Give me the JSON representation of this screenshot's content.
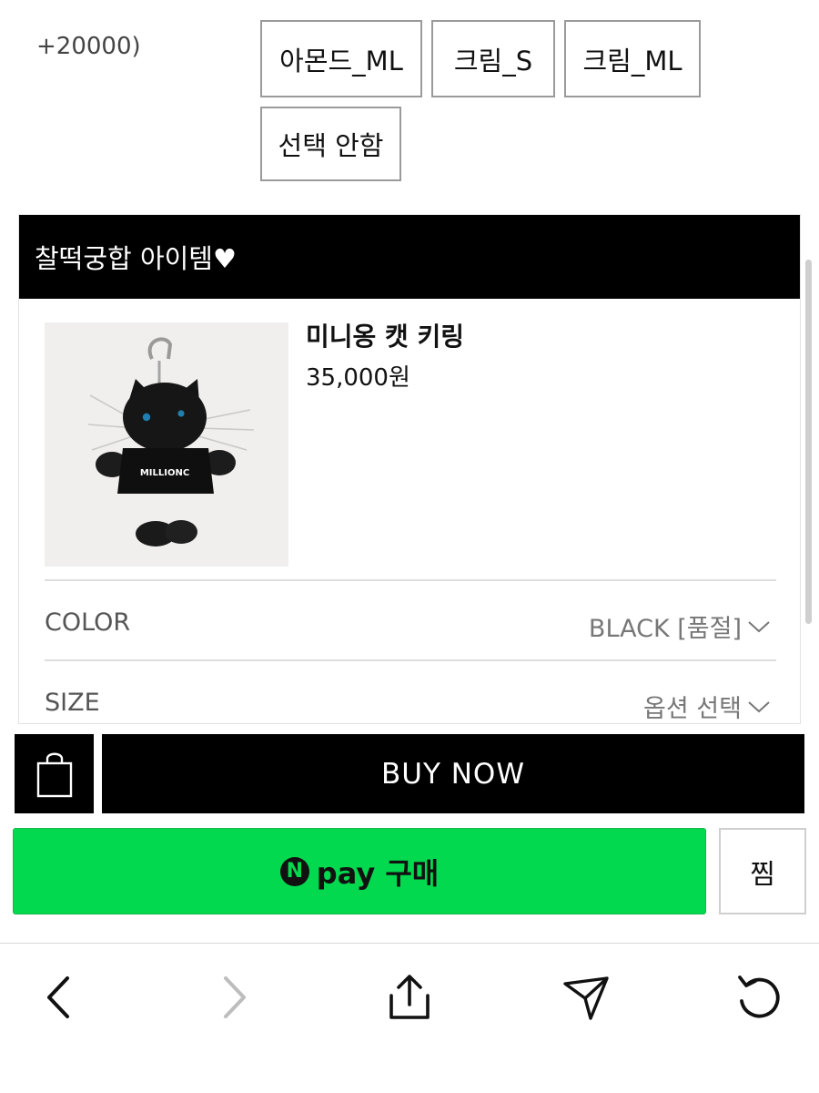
{
  "options": {
    "prev_label": "+20000)",
    "buttons": [
      "아몬드_ML",
      "크림_S",
      "크림_ML",
      "선택 안함"
    ]
  },
  "recommend": {
    "title": "찰떡궁합 아이템♥",
    "product": {
      "name": "미니옹 캣 키링",
      "price": "35,000원",
      "shirt_text": "MILLIONC"
    },
    "rows": [
      {
        "label": "COLOR",
        "value": "BLACK [품절]"
      },
      {
        "label": "SIZE",
        "value": "옵션 선택"
      }
    ]
  },
  "actions": {
    "buy_now": "BUY NOW",
    "npay_logo": "N",
    "npay_label": "pay 구매",
    "zzim": "찜"
  },
  "icons": {
    "bag": "shopping-bag-icon",
    "back": "arrow-left-icon",
    "forward": "arrow-right-icon",
    "share": "share-icon",
    "send": "send-icon",
    "refresh": "refresh-icon"
  },
  "colors": {
    "npay_green": "#03d94f",
    "black": "#000000",
    "forward_disabled": "#bdbdbd"
  }
}
